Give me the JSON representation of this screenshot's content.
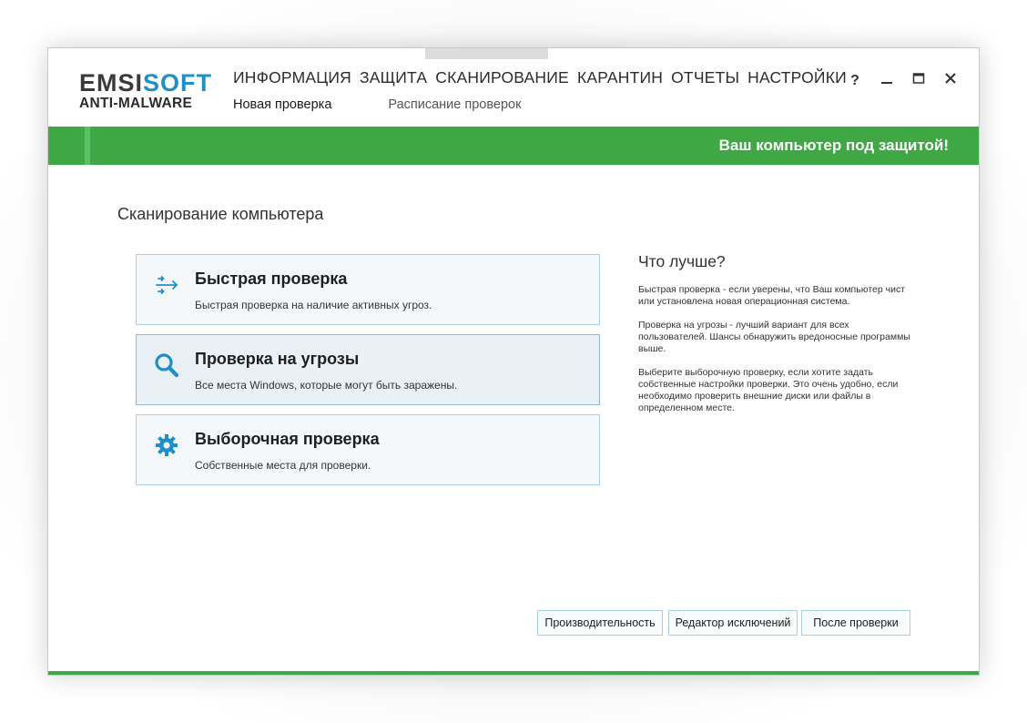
{
  "app": {
    "logo_brand_a": "EMSI",
    "logo_brand_b": "SOFT",
    "logo_product": "ANTI-MALWARE",
    "accent_color": "#1f8ec9",
    "status_color": "#3fa845"
  },
  "nav": {
    "items": [
      {
        "label": "ИНФОРМАЦИЯ"
      },
      {
        "label": "ЗАЩИТА"
      },
      {
        "label": "СКАНИРОВАНИЕ",
        "active": true
      },
      {
        "label": "КАРАНТИН"
      },
      {
        "label": "ОТЧЕТЫ"
      },
      {
        "label": "НАСТРОЙКИ"
      }
    ]
  },
  "subnav": {
    "items": [
      {
        "label": "Новая проверка",
        "active": true
      },
      {
        "label": "Расписание проверок"
      }
    ]
  },
  "window_controls": {
    "help": "?",
    "minimize": "_",
    "maximize": "□",
    "close": "✕"
  },
  "status": {
    "text": "Ваш компьютер под защитой!"
  },
  "main": {
    "title": "Сканирование компьютера",
    "options": [
      {
        "title": "Быстрая проверка",
        "desc": "Быстрая проверка на наличие активных угроз.",
        "icon": "quick-scan-arrows-icon"
      },
      {
        "title": "Проверка на угрозы",
        "desc": "Все места Windows, которые могут быть заражены.",
        "icon": "magnifier-icon",
        "selected": true
      },
      {
        "title": "Выборочная проверка",
        "desc": "Собственные места для проверки.",
        "icon": "gear-icon"
      }
    ]
  },
  "help": {
    "title": "Что лучше?",
    "paragraphs": [
      "Быстрая проверка - если уверены, что Ваш компьютер чист или установлена новая операционная система.",
      "Проверка на угрозы - лучший вариант для всех пользователей. Шансы обнаружить вредоносные программы выше.",
      "Выберите выборочную проверку, если хотите задать собственные настройки проверки. Это очень удобно, если необходимо проверить внешние диски или файлы в определенном месте."
    ]
  },
  "buttons": {
    "performance": "Производительность",
    "exclusions": "Редактор исключений",
    "after_scan": "После проверки"
  }
}
